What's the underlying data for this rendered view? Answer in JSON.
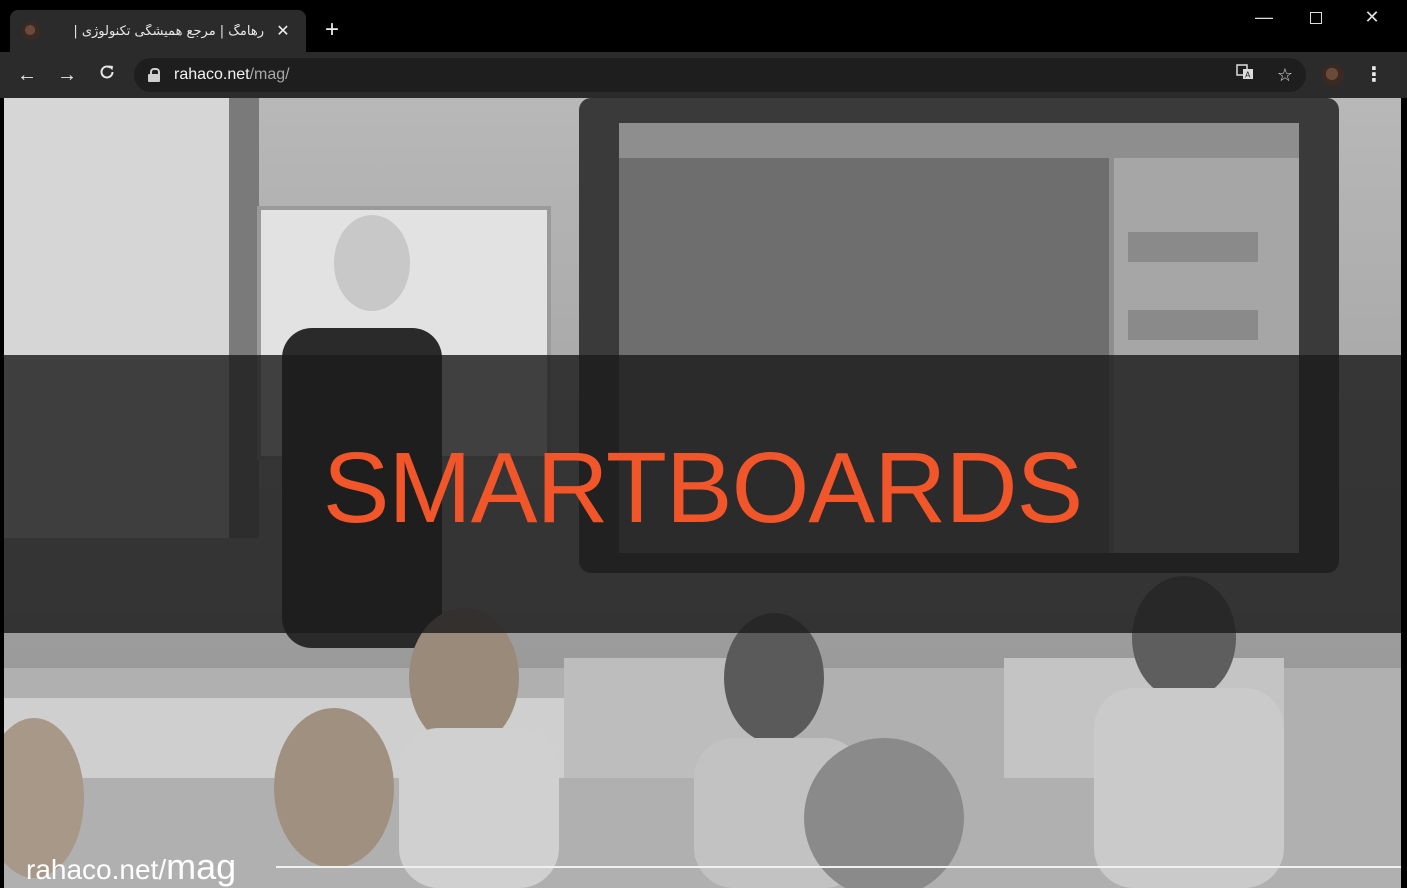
{
  "browser": {
    "tab": {
      "title": "رهامگ | مرجع همیشگی تکنولوژی |",
      "close_glyph": "✕",
      "favicon": "site-favicon"
    },
    "new_tab_glyph": "+",
    "window_controls": {
      "minimize": "—",
      "close": "✕"
    },
    "nav": {
      "back": "←",
      "forward": "→",
      "reload": "C"
    },
    "address": {
      "host": "rahaco.net",
      "path": "/mag/"
    },
    "icons": {
      "translate": "translate-icon",
      "star": "☆",
      "menu": "⋮"
    }
  },
  "page": {
    "headline": "SMARTBOARDS",
    "watermark": {
      "domain": "rahaco.net/",
      "path": "mag"
    },
    "colors": {
      "accent": "#f0562a",
      "banner": "#1c1c1c"
    }
  }
}
